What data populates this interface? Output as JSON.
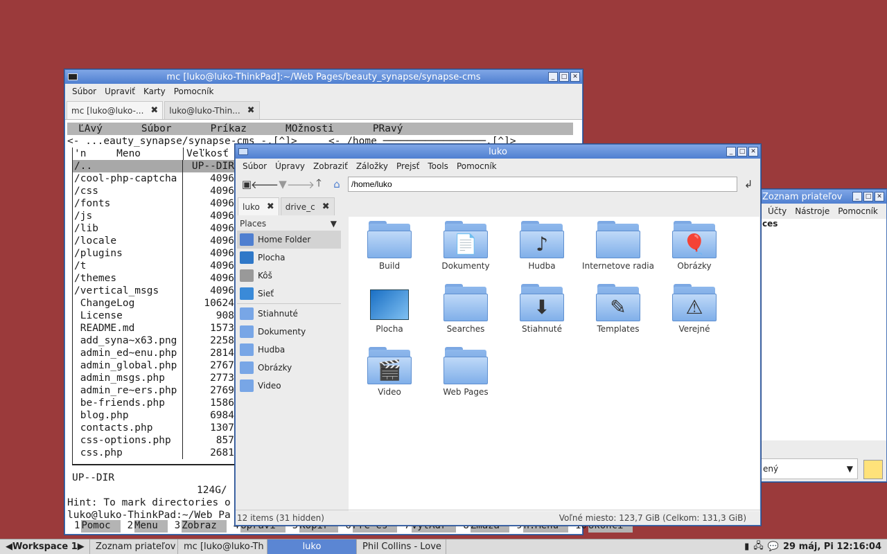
{
  "terminal": {
    "title": "mc [luko@luko-ThinkPad]:~/Web Pages/beauty_synapse/synapse-cms",
    "menu": [
      "Súbor",
      "Upraviť",
      "Karty",
      "Pomocník"
    ],
    "tabs": [
      {
        "label": "mc [luko@luko-..."
      },
      {
        "label": "luko@luko-Thin..."
      }
    ],
    "mc_menu": [
      "ĽAvý",
      "Súbor",
      "Príkaz",
      "MOžnosti",
      "PRavý"
    ],
    "left_path_line": "<- ...eauty_synapse/synapse-cms -.[^]>",
    "right_path_line": "<- /home ─────────────────.[^]>",
    "col_name": "'n     Meno",
    "col_size": "Veľkosť",
    "files": [
      {
        "name": "/..",
        "size": "UP--DIR"
      },
      {
        "name": "/cool-php-captcha",
        "size": "4096"
      },
      {
        "name": "/css",
        "size": "4096"
      },
      {
        "name": "/fonts",
        "size": "4096"
      },
      {
        "name": "/js",
        "size": "4096"
      },
      {
        "name": "/lib",
        "size": "4096"
      },
      {
        "name": "/locale",
        "size": "4096"
      },
      {
        "name": "/plugins",
        "size": "4096"
      },
      {
        "name": "/t",
        "size": "4096"
      },
      {
        "name": "/themes",
        "size": "4096"
      },
      {
        "name": "/vertical_msgs",
        "size": "4096"
      },
      {
        "name": " ChangeLog",
        "size": "10624"
      },
      {
        "name": " License",
        "size": "908"
      },
      {
        "name": " README.md",
        "size": "1573"
      },
      {
        "name": " add_syna~x63.png",
        "size": "2258"
      },
      {
        "name": " admin_ed~enu.php",
        "size": "2814"
      },
      {
        "name": " admin_global.php",
        "size": "2767"
      },
      {
        "name": " admin_msgs.php",
        "size": "2773"
      },
      {
        "name": " admin_re~ers.php",
        "size": "2769"
      },
      {
        "name": " be-friends.php",
        "size": "1586"
      },
      {
        "name": " blog.php",
        "size": "6984"
      },
      {
        "name": " contacts.php",
        "size": "1307"
      },
      {
        "name": " css-options.php",
        "size": "857"
      },
      {
        "name": " css.php",
        "size": "2681"
      }
    ],
    "mini_status": "UP--DIR",
    "free_space": "124G/",
    "hint": "Hint: To mark directories o",
    "prompt": "luko@luko-ThinkPad:~/Web Pa",
    "fkeys": [
      {
        "k": "1",
        "l": "Pomoc"
      },
      {
        "k": "2",
        "l": "Menu"
      },
      {
        "k": "3",
        "l": "Zobraz"
      },
      {
        "k": "4",
        "l": "Upravi"
      },
      {
        "k": "5",
        "l": "Kopír"
      },
      {
        "k": "6",
        "l": "Pre~es"
      },
      {
        "k": "7",
        "l": "VytAdr"
      },
      {
        "k": "8",
        "l": "Zmaza"
      },
      {
        "k": "9",
        "l": "h.Menu"
      },
      {
        "k": "10",
        "l": "Ukonči"
      }
    ]
  },
  "filemanager": {
    "title": "luko",
    "menu": [
      "Súbor",
      "Úpravy",
      "Zobraziť",
      "Záložky",
      "Prejsť",
      "Tools",
      "Pomocník"
    ],
    "address": "/home/luko",
    "tabs": [
      {
        "label": "luko"
      },
      {
        "label": "drive_c"
      }
    ],
    "places_header": "Places",
    "places": [
      {
        "label": "Home Folder",
        "icon": "home-icon",
        "selected": true
      },
      {
        "label": "Plocha",
        "icon": "desktop-icon"
      },
      {
        "label": "Kôš",
        "icon": "trash-icon"
      },
      {
        "label": "Sieť",
        "icon": "network-icon"
      }
    ],
    "bookmarks": [
      {
        "label": "Stiahnuté",
        "icon": "download-folder-icon"
      },
      {
        "label": "Dokumenty",
        "icon": "documents-folder-icon"
      },
      {
        "label": "Hudba",
        "icon": "music-folder-icon"
      },
      {
        "label": "Obrázky",
        "icon": "pictures-folder-icon"
      },
      {
        "label": "Video",
        "icon": "video-folder-icon"
      }
    ],
    "items": [
      {
        "label": "Build",
        "emblem": ""
      },
      {
        "label": "Dokumenty",
        "emblem": "📄"
      },
      {
        "label": "Hudba",
        "emblem": "♪"
      },
      {
        "label": "Internetove radia",
        "emblem": ""
      },
      {
        "label": "Obrázky",
        "emblem": "🎈"
      },
      {
        "label": "Plocha",
        "emblem": "desktop"
      },
      {
        "label": "Searches",
        "emblem": ""
      },
      {
        "label": "Stiahnuté",
        "emblem": "⬇"
      },
      {
        "label": "Templates",
        "emblem": "✎"
      },
      {
        "label": "Verejné",
        "emblem": "⚠"
      },
      {
        "label": "Video",
        "emblem": "🎬"
      },
      {
        "label": "Web Pages",
        "emblem": ""
      }
    ],
    "status_left": "12 items (31 hidden)",
    "status_right": "Voľné miesto: 123,7 GiB (Celkom: 131,3 GiB)"
  },
  "chat": {
    "title": "Zoznam priateľov",
    "menu": [
      "Účty",
      "Nástroje",
      "Pomocník"
    ],
    "section": "ces",
    "status": "ený"
  },
  "taskbar": {
    "workspace": "Workspace 1",
    "buttons": [
      {
        "label": "Zoznam priateľov"
      },
      {
        "label": "mc [luko@luko-Th"
      },
      {
        "label": "luko"
      },
      {
        "label": "Phil Collins - Love"
      }
    ],
    "clock": "29 máj, Pi 12:16:04"
  },
  "colors": {
    "desktop": "#9b3a3b",
    "titlebar": "#5b86d3",
    "selection": "#a8a8a8"
  }
}
